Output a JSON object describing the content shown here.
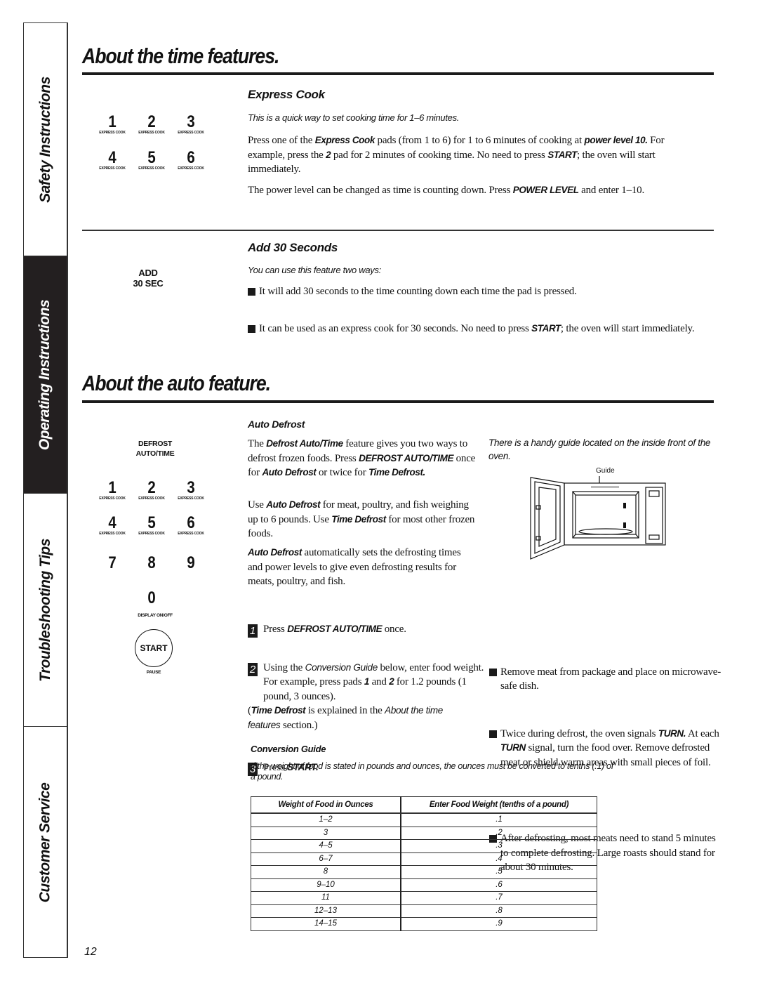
{
  "sidebar": {
    "tabs": [
      {
        "label": "Safety Instructions",
        "active": false
      },
      {
        "label": "Operating Instructions",
        "active": true
      },
      {
        "label": "Troubleshooting Tips",
        "active": false
      },
      {
        "label": "Customer Service",
        "active": false
      }
    ]
  },
  "time_section": {
    "title": "About the time features.",
    "express_cook": {
      "heading": "Express Cook",
      "intro": "This is a quick way to set cooking time for 1–6 minutes.",
      "p1": {
        "t1": "Press one of the ",
        "b1": "Express Cook",
        "t2": " pads (from 1 to 6) for 1 to 6 minutes of cooking at ",
        "b2": "power level 10.",
        "t3": " For example, press the ",
        "b3": "2",
        "t4": " pad for 2 minutes of cooking time. No need to press ",
        "b4": "START",
        "t5": "; the oven will start immediately."
      },
      "p2": {
        "t1": "The power level can be changed as time is counting down. Press ",
        "b1": "POWER LEVEL",
        "t2": " and enter 1–10."
      },
      "keypad": [
        {
          "num": "1",
          "label": "EXPRESS COOK"
        },
        {
          "num": "2",
          "label": "EXPRESS COOK"
        },
        {
          "num": "3",
          "label": "EXPRESS COOK"
        },
        {
          "num": "4",
          "label": "EXPRESS COOK"
        },
        {
          "num": "5",
          "label": "EXPRESS COOK"
        },
        {
          "num": "6",
          "label": "EXPRESS COOK"
        }
      ]
    },
    "add30": {
      "heading": "Add 30 Seconds",
      "intro": "You can use this feature two ways:",
      "key_line1": "ADD",
      "key_line2": "30 SEC",
      "bullet1": "It will add 30 seconds to the time counting down each time the pad is pressed.",
      "bullet2": {
        "t1": "It can be used as an express cook for 30 seconds. No need to press ",
        "b1": "START",
        "t2": "; the oven will start immediately."
      }
    }
  },
  "auto_section": {
    "title": "About the auto feature.",
    "keypad": {
      "defrost_line1": "DEFROST",
      "defrost_line2": "AUTO/TIME",
      "keys": [
        {
          "num": "1",
          "label": "EXPRESS COOK"
        },
        {
          "num": "2",
          "label": "EXPRESS COOK"
        },
        {
          "num": "3",
          "label": "EXPRESS COOK"
        },
        {
          "num": "4",
          "label": "EXPRESS COOK"
        },
        {
          "num": "5",
          "label": "EXPRESS COOK"
        },
        {
          "num": "6",
          "label": "EXPRESS COOK"
        },
        {
          "num": "7",
          "label": ""
        },
        {
          "num": "8",
          "label": ""
        },
        {
          "num": "9",
          "label": ""
        },
        {
          "num": "0",
          "label": ""
        }
      ],
      "display_label": "DISPLAY ON/OFF",
      "start_label": "START",
      "pause_label": "PAUSE"
    },
    "auto_defrost": {
      "heading": "Auto Defrost",
      "p1": {
        "t1": "The ",
        "b1": "Defrost Auto/Time",
        "t2": " feature gives you two ways to defrost frozen foods. Press ",
        "b2": "DEFROST AUTO/TIME",
        "t3": " once  for ",
        "b3": "Auto Defrost",
        "t4": " or twice for ",
        "b4": "Time Defrost."
      },
      "p2": {
        "t1": "Use ",
        "b1": "Auto Defrost",
        "t2": " for meat, poultry, and fish weighing up to 6 pounds. Use ",
        "b2": "Time Defrost",
        "t3": " for most other frozen foods."
      },
      "p3": {
        "b1": "Auto Defrost",
        "t1": " automatically sets the defrosting times and power levels to give even defrosting results for meats, poultry, and fish."
      },
      "steps": [
        {
          "n": "1",
          "t1": "Press ",
          "b1": "DEFROST AUTO/TIME",
          "t2": " once."
        },
        {
          "n": "2",
          "t1": "Using the ",
          "i1": "Conversion Guide",
          "t2": " below, enter food weight. For example, press pads ",
          "b1": "1",
          "t3": " and ",
          "b2": "2",
          "t4": " for 1.2 pounds  (1 pound, 3 ounces)."
        },
        {
          "n": "3",
          "t1": "Press ",
          "b1": "START."
        }
      ],
      "note": {
        "t1": "(",
        "b1": "Time Defrost",
        "t2": " is explained in the ",
        "i1": "About the time features",
        "t3": " section.)"
      }
    },
    "guide_note": "There is a handy guide located on the inside front of the oven.",
    "figure_label": "Guide",
    "tips": [
      "Remove meat from package and place on microwave-safe dish.",
      {
        "t1": "Twice during defrost, the oven signals ",
        "b1": "TURN.",
        "t2": " At each ",
        "b2": "TURN",
        "t3": " signal, turn the food over. Remove defrosted meat or shield warm areas with small pieces of foil."
      },
      "After defrosting, most meats need to stand 5 minutes to complete defrosting. Large roasts should stand for about 30 minutes."
    ],
    "conversion_guide": {
      "heading": "Conversion Guide",
      "intro": "If the weight of food is stated in pounds and ounces, the ounces must be converted to tenths (.1) of a pound.",
      "columns": [
        "Weight of Food in Ounces",
        "Enter Food Weight (tenths of a pound)"
      ],
      "rows": [
        [
          "1–2",
          ".1"
        ],
        [
          "3",
          ".2"
        ],
        [
          "4–5",
          ".3"
        ],
        [
          "6–7",
          ".4"
        ],
        [
          "8",
          ".5"
        ],
        [
          "9–10",
          ".6"
        ],
        [
          "11",
          ".7"
        ],
        [
          "12–13",
          ".8"
        ],
        [
          "14–15",
          ".9"
        ]
      ]
    }
  },
  "page_number": "12"
}
